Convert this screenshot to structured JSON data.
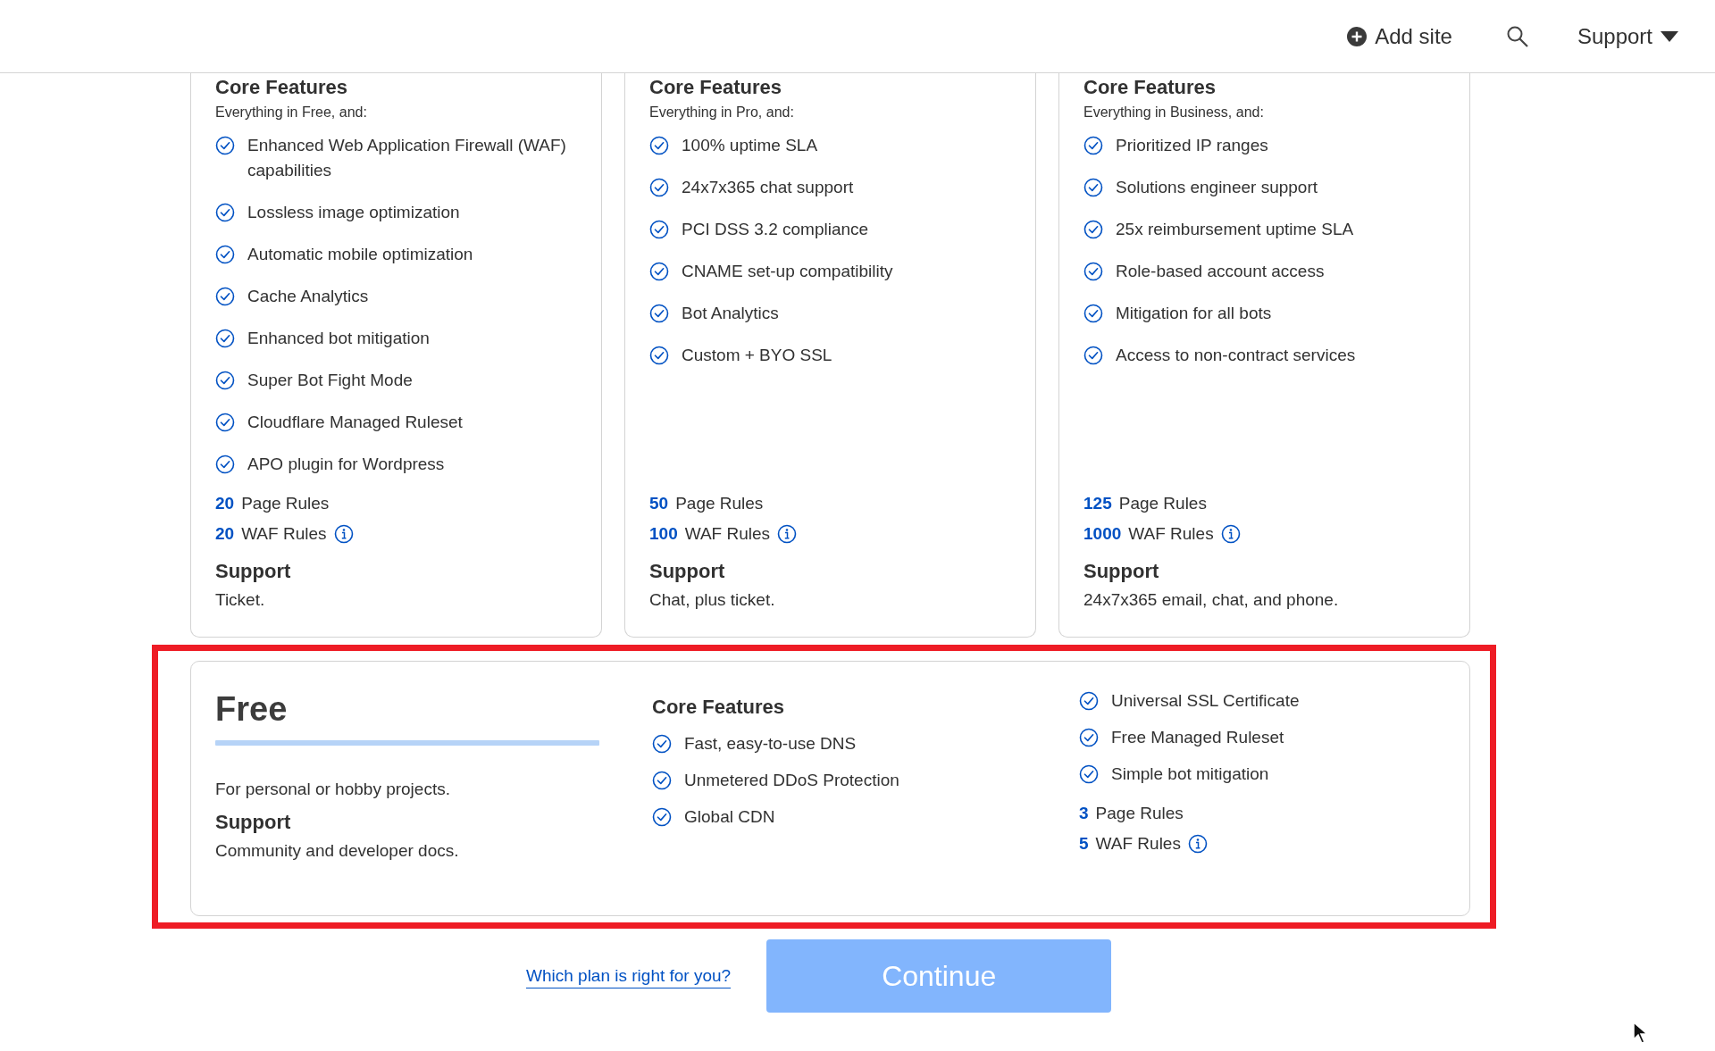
{
  "header": {
    "add_site": "Add site",
    "support_menu": "Support"
  },
  "plans": [
    {
      "heading": "Core Features",
      "subheading": "Everything in Free, and:",
      "features": [
        "Enhanced Web Application Firewall (WAF) capabilities",
        "Lossless image optimization",
        "Automatic mobile optimization",
        "Cache Analytics",
        "Enhanced bot mitigation",
        "Super Bot Fight Mode",
        "Cloudflare Managed Ruleset",
        "APO plugin for Wordpress"
      ],
      "page_rules_count": "20",
      "page_rules_label": "Page Rules",
      "waf_rules_count": "20",
      "waf_rules_label": "WAF Rules",
      "support_title": "Support",
      "support_text": "Ticket."
    },
    {
      "heading": "Core Features",
      "subheading": "Everything in Pro, and:",
      "features": [
        "100% uptime SLA",
        "24x7x365 chat support",
        "PCI DSS 3.2 compliance",
        "CNAME set-up compatibility",
        "Bot Analytics",
        "Custom + BYO SSL"
      ],
      "page_rules_count": "50",
      "page_rules_label": "Page Rules",
      "waf_rules_count": "100",
      "waf_rules_label": "WAF Rules",
      "support_title": "Support",
      "support_text": "Chat, plus ticket."
    },
    {
      "heading": "Core Features",
      "subheading": "Everything in Business, and:",
      "features": [
        "Prioritized IP ranges",
        "Solutions engineer support",
        "25x reimbursement uptime SLA",
        "Role-based account access",
        "Mitigation for all bots",
        "Access to non-contract services"
      ],
      "page_rules_count": "125",
      "page_rules_label": "Page Rules",
      "waf_rules_count": "1000",
      "waf_rules_label": "WAF Rules",
      "support_title": "Support",
      "support_text": "24x7x365 email, chat, and phone."
    }
  ],
  "free_plan": {
    "highlighted": true,
    "name": "Free",
    "tagline": "For personal or hobby projects.",
    "support_title": "Support",
    "support_text": "Community and developer docs.",
    "features_heading": "Core Features",
    "features": [
      "Fast, easy-to-use DNS",
      "Unmetered DDoS Protection",
      "Global CDN"
    ],
    "extra_features": [
      "Universal SSL Certificate",
      "Free Managed Ruleset",
      "Simple bot mitigation"
    ],
    "page_rules_count": "3",
    "page_rules_label": "Page Rules",
    "waf_rules_count": "5",
    "waf_rules_label": "WAF Rules"
  },
  "footer": {
    "help_link": "Which plan is right for you?",
    "continue_button": {
      "label": "Continue",
      "disabled": true
    }
  }
}
